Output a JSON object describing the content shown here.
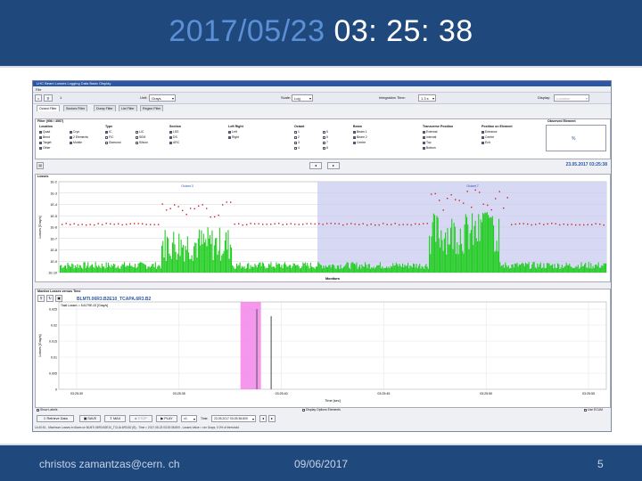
{
  "slide": {
    "title_date": "2017/05/23",
    "title_time": "03: 25: 38",
    "footer_email": "christos zamantzas@cern. ch",
    "footer_date": "09/06/2017",
    "page_number": "5",
    "colors": {
      "bar": "#1f497d",
      "date_accent": "#5b8fd6"
    }
  },
  "app": {
    "window_title": "LHC Beam Losses Logging Data Basic Display",
    "menu_file": "File",
    "toolbar": {
      "page_value": "1",
      "unit_label": "Unit:",
      "unit_value": "Grays",
      "scale_label": "Scale:",
      "scale_value": "Log",
      "integration_label": "Integration Time:",
      "integration_value": "1.3 s",
      "display_label": "Display:",
      "display_value": "Location"
    },
    "tabs": [
      "Octant Filter",
      "Sectors Filter",
      "Dump Filter",
      "List Filter",
      "Region Filter"
    ],
    "filter": {
      "caption": "Filter (956 / 3557)",
      "columns": [
        {
          "head": "Location",
          "items": [
            {
              "label": "Quad",
              "on": true
            },
            {
              "label": "Bend",
              "on": true
            },
            {
              "label": "Target",
              "on": true
            },
            {
              "label": "Other",
              "on": true
            }
          ]
        },
        {
          "head": "",
          "items": [
            {
              "label": "Cryo",
              "on": true
            },
            {
              "label": "2 Elements",
              "on": true
            },
            {
              "label": "Mobile",
              "on": true
            }
          ]
        },
        {
          "head": "Type",
          "items": [
            {
              "label": "IC",
              "on": true
            },
            {
              "label": "FIC",
              "on": false
            },
            {
              "label": "Diamond",
              "on": false
            }
          ]
        },
        {
          "head": "",
          "items": [
            {
              "label": "LIC",
              "on": false
            },
            {
              "label": "SEM",
              "on": false
            },
            {
              "label": "Silicon",
              "on": false
            }
          ]
        },
        {
          "head": "Section",
          "items": [
            {
              "label": "LSS",
              "on": true
            },
            {
              "label": "DS",
              "on": true
            },
            {
              "label": "ARC",
              "on": true
            }
          ]
        },
        {
          "head": "Left Right",
          "items": [
            {
              "label": "Left",
              "on": true
            },
            {
              "label": "Right",
              "on": true
            }
          ]
        },
        {
          "head": "Octant",
          "items": [
            {
              "label": "1",
              "on": false
            },
            {
              "label": "2",
              "on": false
            },
            {
              "label": "3",
              "on": false
            },
            {
              "label": "4",
              "on": false
            }
          ]
        },
        {
          "head": "",
          "items": [
            {
              "label": "5",
              "on": false
            },
            {
              "label": "6",
              "on": false
            },
            {
              "label": "7",
              "on": false
            },
            {
              "label": "8",
              "on": false
            }
          ]
        },
        {
          "head": "Beam",
          "items": [
            {
              "label": "Beam 1",
              "on": true
            },
            {
              "label": "Beam 2",
              "on": true
            },
            {
              "label": "Centre",
              "on": true
            }
          ]
        },
        {
          "head": "Transverse Position",
          "items": [
            {
              "label": "External",
              "on": true
            },
            {
              "label": "Internal",
              "on": true
            },
            {
              "label": "Top",
              "on": true
            },
            {
              "label": "Bottom",
              "on": true
            }
          ]
        },
        {
          "head": "Position on Element",
          "items": [
            {
              "label": "Entrance",
              "on": true
            },
            {
              "label": "Centre",
              "on": true
            },
            {
              "label": "Exit",
              "on": true
            }
          ]
        }
      ],
      "observed_head": "Observed Element",
      "observed_value": "%"
    },
    "timestamp": "23.05.2017 03:25:38",
    "losses_panel": {
      "title": "Losses",
      "ylabel": "Losses [Gray/s]",
      "xlabel": "Monitors",
      "yticks": [
        "1E-2",
        "1E-3",
        "1E-4",
        "1E-5",
        "1E-6",
        "1E-7",
        "1E-8",
        "1E-9",
        "1E-10"
      ],
      "octant_labels": [
        "Octant 3",
        "Octant 7"
      ]
    },
    "monitor_panel": {
      "title": "Monitor Losses versus Time",
      "monitor_name": "BLMTI.06R3.B2E10_TCAPA.6R3.B2",
      "legend": "Total Losses = 5.6179E-02 [Gray/s]",
      "ylabel": "Losses [Gray/s]",
      "xlabel": "Time [sec]",
      "yticks": [
        "0.025",
        "0.02",
        "0.015",
        "0.01",
        "0.005",
        "0"
      ],
      "xticks": [
        "03:25:30",
        "03:25:35",
        "03:25:40",
        "03:25:45",
        "03:25:50",
        "03:25:55"
      ]
    },
    "options": {
      "show_labels": "Show Labels",
      "display_options": "Display Options Elements",
      "use_ecum": "Use ECUM"
    },
    "controls": {
      "retrieve": "Retrieve Data",
      "save": "SAVE",
      "max": "MAX",
      "stop": "STOP",
      "play": "PLAY",
      "speed": "x1",
      "time_label": "Time:",
      "time_value": "23.05.2017 03:25:38.800"
    },
    "status": "14:40:51 - Maximum Losses in Alarm on BLMTI.06R3.B2E10_TCLIA.6R3.B2 (B) - Time = 2017-05-23 03:25:38.800 - Losses Value = xxx Grays, 0.0% of threshold"
  },
  "chart_data": [
    {
      "type": "bar",
      "title": "Losses",
      "xlabel": "Monitors",
      "ylabel": "Losses [Gray/s]",
      "log_scale": true,
      "ylim": [
        "1E-10",
        "1E-2"
      ],
      "annotations": [
        "Octant 3",
        "Octant 7"
      ],
      "highlighted_region": "Octant 7 shaded blue",
      "series": [
        {
          "color": "#22cc22"
        },
        {
          "color": "#cc2222"
        }
      ]
    },
    {
      "type": "bar",
      "title": "Monitor Losses versus Time",
      "xlabel": "Time [sec]",
      "ylabel": "Losses [Gray/s]",
      "ylim": [
        0,
        0.025
      ],
      "categories": [
        "03:25:30",
        "03:25:35",
        "03:25:40",
        "03:25:45",
        "03:25:50",
        "03:25:55"
      ],
      "series": [
        {
          "name": "Total Losses = 5.6179E-02 [Gray/s]",
          "points": [
            {
              "t": "03:25:38.8",
              "value": 0.025
            },
            {
              "t": "03:25:39.5",
              "value": 0.0228
            }
          ]
        }
      ],
      "highlight_band": {
        "from": "03:25:38",
        "to": "03:25:39"
      },
      "grid": true
    }
  ]
}
